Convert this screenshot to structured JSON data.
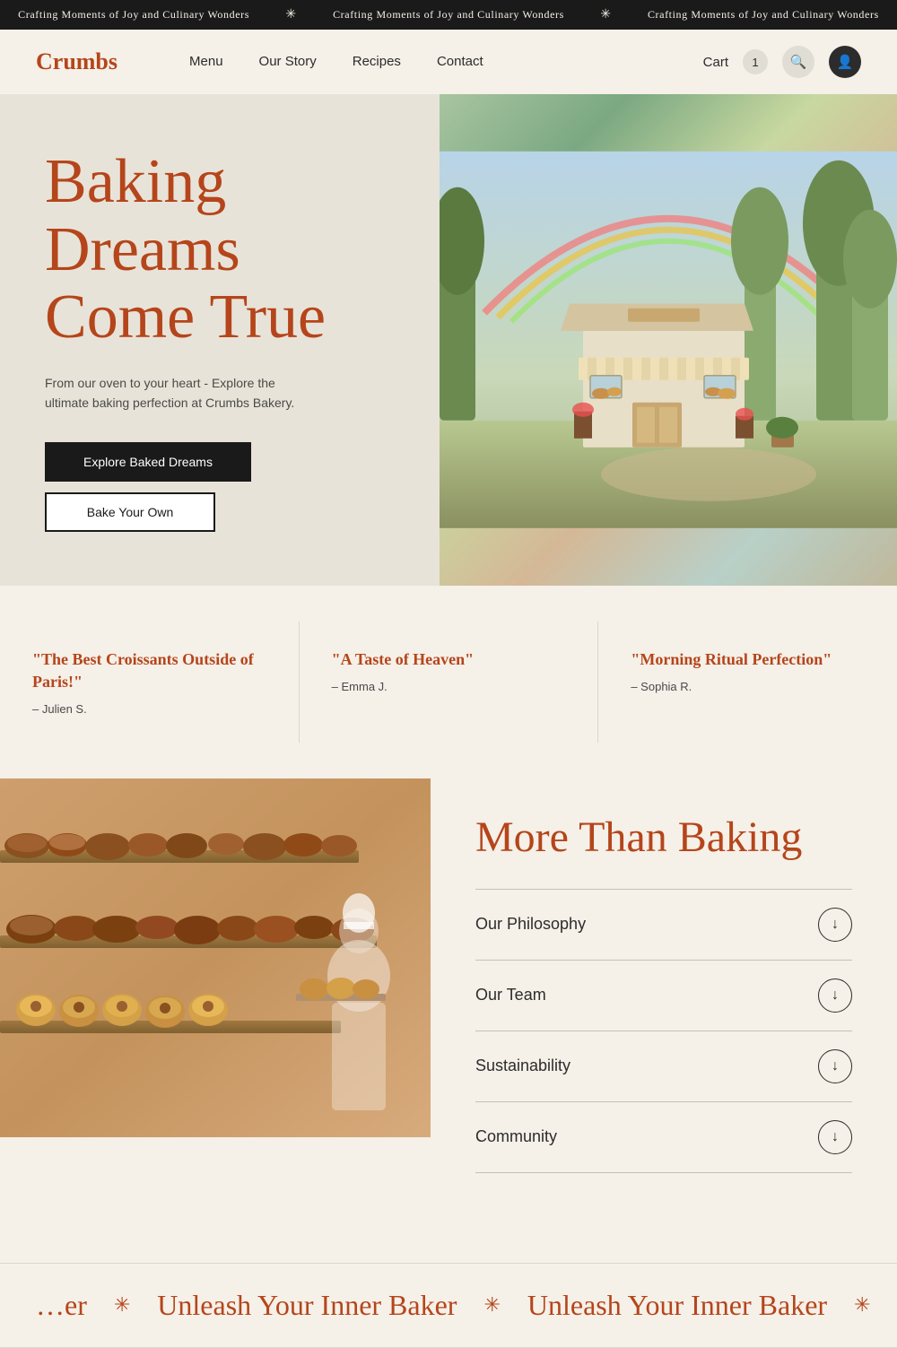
{
  "top_banner": {
    "text": "Crafting Moments of Joy and Culinary Wonders",
    "separator": "✳"
  },
  "navbar": {
    "logo": "Crumbs",
    "links": [
      {
        "label": "Menu",
        "href": "#"
      },
      {
        "label": "Our Story",
        "href": "#"
      },
      {
        "label": "Recipes",
        "href": "#"
      },
      {
        "label": "Contact",
        "href": "#"
      }
    ],
    "cart_label": "Cart",
    "cart_count": "1",
    "search_icon": "🔍",
    "user_icon": "👤"
  },
  "hero": {
    "title_line1": "Baking",
    "title_line2": "Dreams",
    "title_line3": "Come True",
    "subtitle": "From our oven to your heart - Explore the ultimate baking perfection at Crumbs Bakery.",
    "btn_primary": "Explore Baked Dreams",
    "btn_secondary": "Bake Your Own"
  },
  "testimonials": [
    {
      "quote": "\"The Best Croissants Outside of Paris!\"",
      "author": "– Julien S."
    },
    {
      "quote": "\"A Taste of Heaven\"",
      "author": "– Emma J."
    },
    {
      "quote": "\"Morning Ritual Perfection\"",
      "author": "– Sophia R."
    }
  ],
  "more_section": {
    "title": "More Than Baking",
    "accordion": [
      {
        "label": "Our Philosophy"
      },
      {
        "label": "Our Team"
      },
      {
        "label": "Sustainability"
      },
      {
        "label": "Community"
      }
    ]
  },
  "bottom_banner": {
    "text": "Unleash Your Inner Baker",
    "separator": "✳"
  }
}
